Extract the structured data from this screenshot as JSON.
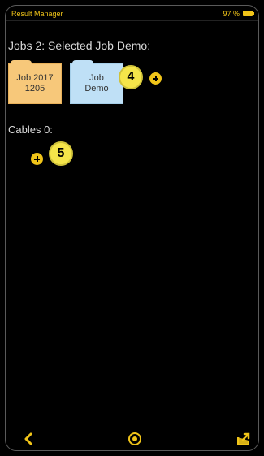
{
  "status_bar": {
    "title": "Result Manager",
    "battery_text": "97 %",
    "battery_icon": "battery-icon"
  },
  "jobs": {
    "heading": "Jobs 2: Selected Job Demo:",
    "cards": [
      {
        "label": "Job 2017\n1205",
        "color": "#f7c87a"
      },
      {
        "label": "Job\nDemo",
        "color": "#bfe0f6"
      }
    ],
    "add_icon": "add-circle-icon"
  },
  "markers": [
    "4",
    "5"
  ],
  "cables": {
    "heading": "Cables 0:",
    "add_icon": "add-circle-icon"
  },
  "nav": {
    "back_icon": "chevron-left-icon",
    "home_icon": "circle-target-icon",
    "share_icon": "share-export-icon"
  },
  "colors": {
    "accent": "#f0c419",
    "marker": "#f5e54a",
    "background": "#000000"
  }
}
